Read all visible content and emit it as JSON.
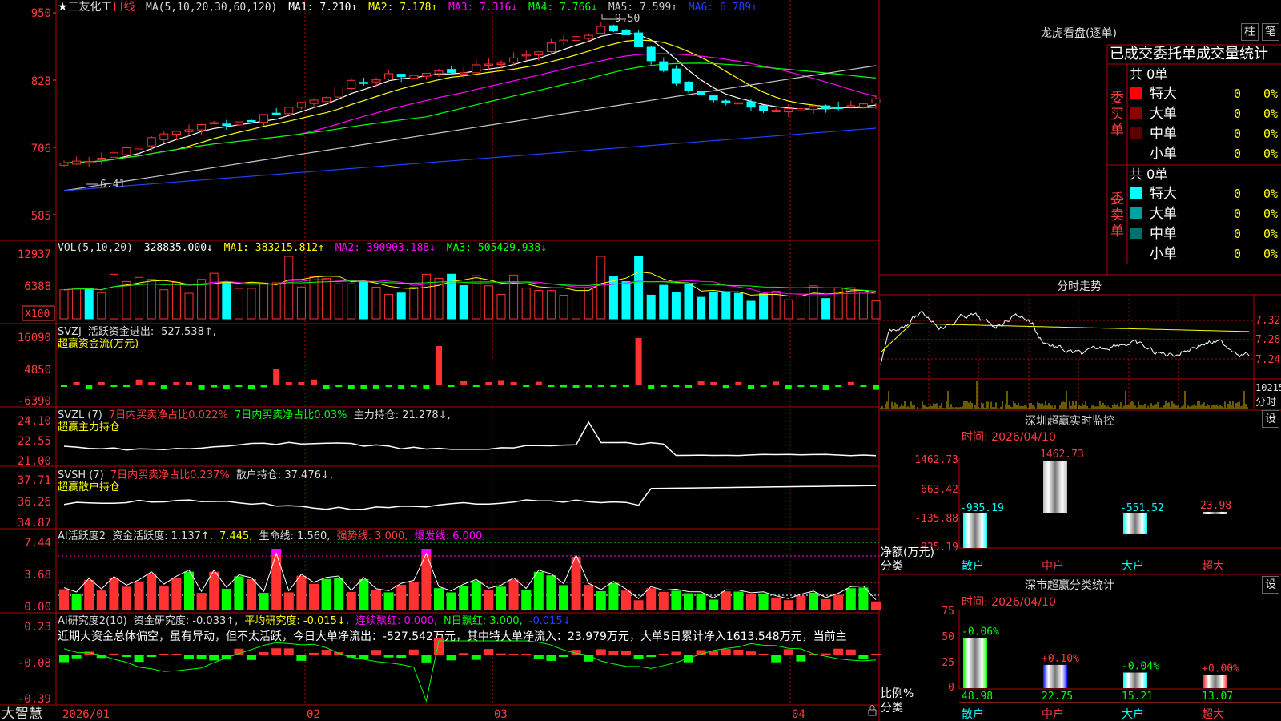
{
  "app": {
    "brand": "大智慧",
    "date_label": "2026/01"
  },
  "colors": {
    "up": "#ff3232",
    "down": "#00ffff",
    "grid": "#b40000",
    "axis": "#ff3c3c",
    "text": "#dcdcdc"
  },
  "kline": {
    "star": "★",
    "stock_name": "三友化工",
    "period": "日线",
    "ma_params": "MA(5,10,20,30,60,120)",
    "ma1": "MA1: 7.210↑",
    "ma2": "MA2: 7.178↑",
    "ma3": "MA3: 7.316↓",
    "ma4": "MA4: 7.766↓",
    "ma5": "MA5: 7.599↑",
    "ma6": "MA6: 6.789↑",
    "high_mark": "9.50",
    "low_mark": "6.41",
    "y_ticks": [
      "950",
      "828",
      "706",
      "585"
    ]
  },
  "vol": {
    "label": "VOL(5,10,20)",
    "value": "328835.000↓",
    "ma1": "MA1: 383215.812↑",
    "ma2": "MA2: 390903.188↓",
    "ma3": "MA3: 505429.938↓",
    "y_ticks": [
      "12937",
      "6388"
    ],
    "unit": "X100"
  },
  "svzj": {
    "label": "SVZJ",
    "title": "活跃资金进出: -527.538↑,",
    "subtitle": "超赢资金流(万元)",
    "y_ticks": [
      "16090",
      "4850",
      "-6390"
    ]
  },
  "svzl": {
    "label": "SVZL (7)",
    "part1": "7日内买卖净占比0.022%",
    "part2": "7日内买卖净占比0.03%",
    "part3": "主力持仓: 21.278↓,",
    "subtitle": "超赢主力持仓",
    "y_ticks": [
      "24.10",
      "22.55",
      "21.00"
    ]
  },
  "svsh": {
    "label": "SVSH (7)",
    "part1": "7日内买卖净占比0.237%",
    "part2": "散户持仓: 37.476↓,",
    "subtitle": "超赢散户持仓",
    "y_ticks": [
      "37.71",
      "36.26",
      "34.87"
    ]
  },
  "ai_active": {
    "label": "AI活跃度2",
    "p1": "资金活跃度: 1.137↑,",
    "p2": "7.445,",
    "p3": "生命线: 1.560,",
    "p4": "强势线: 3.000,",
    "p5": "爆发线: 6.000,",
    "y_ticks": [
      "7.44",
      "3.68",
      "0.00"
    ]
  },
  "ai_research": {
    "label": "AI研究度2(10)",
    "p1": "资金研究度: -0.033↑,",
    "p2": "平均研究度: -0.015↓,",
    "p3": "连续飘红: 0.000,",
    "p4": "N日飘红: 3.000,",
    "p5": "-0.015↓",
    "comment": "近期大资金总体偏空，虽有异动，但不太活跃，今日大单净流出：-527.542万元，其中特大单净流入：23.979万元，大单5日累计净入1613.548万元，当前主",
    "y_ticks": [
      "0.23",
      "-0.08",
      "-0.39"
    ]
  },
  "x_labels": [
    "02",
    "03",
    "04"
  ],
  "dragon": {
    "title": "龙虎看盘(逐单)",
    "btn_bar": "柱",
    "btn_pen": "笔",
    "header": "已成交委托单成交量统计",
    "buy_side": "委买单",
    "sell_side": "委卖单",
    "buy_total": "共 0单",
    "sell_total": "共 0单",
    "buy_rows": [
      {
        "name": "特大",
        "count": "0",
        "pct": "0%",
        "color": "#ff0000"
      },
      {
        "name": "大单",
        "count": "0",
        "pct": "0%",
        "color": "#8c0000"
      },
      {
        "name": "中单",
        "count": "0",
        "pct": "0%",
        "color": "#5a0000"
      },
      {
        "name": "小单",
        "count": "0",
        "pct": "0%",
        "color": "#000000"
      }
    ],
    "sell_rows": [
      {
        "name": "特大",
        "count": "0",
        "pct": "0%",
        "color": "#00ffff"
      },
      {
        "name": "大单",
        "count": "0",
        "pct": "0%",
        "color": "#00a0a0"
      },
      {
        "name": "中单",
        "count": "0",
        "pct": "0%",
        "color": "#007070"
      },
      {
        "name": "小单",
        "count": "0",
        "pct": "0%",
        "color": "#000000"
      }
    ]
  },
  "intraday": {
    "title": "分时走势",
    "y_ticks": [
      "7.32",
      "7.28",
      "7.24"
    ],
    "vol_tick": "10215",
    "vol_label": "分时"
  },
  "sz_monitor": {
    "title": "深圳超赢实时监控",
    "settings": "设",
    "time": "时间: 2026/04/10",
    "y_ticks": [
      "1462.73",
      "663.42",
      "-135.88",
      "-935.19"
    ],
    "side_label1": "净额(万元)",
    "side_label2": "分类",
    "bars": [
      {
        "cat": "散户",
        "value": -935.19,
        "label": "-935.19"
      },
      {
        "cat": "中户",
        "value": 1462.73,
        "label": "1462.73"
      },
      {
        "cat": "大户",
        "value": -551.52,
        "label": "-551.52"
      },
      {
        "cat": "超大",
        "value": 23.98,
        "label": "23.98"
      }
    ]
  },
  "sz_class": {
    "title": "深市超赢分类统计",
    "settings": "设",
    "time": "时间: 2026/04/10",
    "y_ticks": [
      "75",
      "50",
      "25",
      "0"
    ],
    "side_label1": "比例%",
    "side_label2": "分类",
    "bars": [
      {
        "cat": "散户",
        "value": 48.98,
        "label": "48.98",
        "change": "-0.06%"
      },
      {
        "cat": "中户",
        "value": 22.75,
        "label": "22.75",
        "change": "+0.10%"
      },
      {
        "cat": "大户",
        "value": 15.21,
        "label": "15.21",
        "change": "-0.04%"
      },
      {
        "cat": "超大",
        "value": 13.07,
        "label": "13.07",
        "change": "+0.00%"
      }
    ]
  }
}
